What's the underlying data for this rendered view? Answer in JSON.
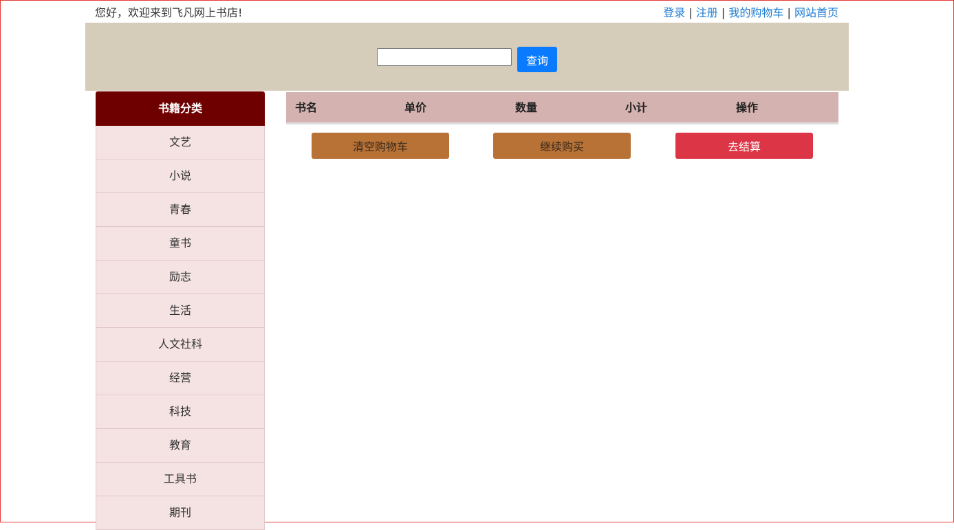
{
  "header": {
    "welcome": "您好，欢迎来到飞凡网上书店!",
    "links": {
      "login": "登录",
      "register": "注册",
      "cart": "我的购物车",
      "home": "网站首页",
      "separator": "|"
    }
  },
  "search": {
    "value": "",
    "placeholder": "",
    "button_label": "查询"
  },
  "sidebar": {
    "title": "书籍分类",
    "items": [
      {
        "label": "文艺"
      },
      {
        "label": "小说"
      },
      {
        "label": "青春"
      },
      {
        "label": "童书"
      },
      {
        "label": "励志"
      },
      {
        "label": "生活"
      },
      {
        "label": "人文社科"
      },
      {
        "label": "经营"
      },
      {
        "label": "科技"
      },
      {
        "label": "教育"
      },
      {
        "label": "工具书"
      },
      {
        "label": "期刊"
      }
    ]
  },
  "cart": {
    "columns": [
      "书名",
      "单价",
      "数量",
      "小计",
      "操作"
    ],
    "actions": {
      "clear": "清空购物车",
      "continue": "继续购买",
      "checkout": "去结算"
    }
  },
  "colors": {
    "banner": "#d6ccba",
    "sidebar_header": "#6f0000",
    "sidebar_item": "#f5e3e3",
    "table_header": "#d3b2b0",
    "search_button": "#0a7bff",
    "action_button": "#b87235",
    "checkout_button": "#dc3545",
    "link": "#1e7cd2"
  }
}
